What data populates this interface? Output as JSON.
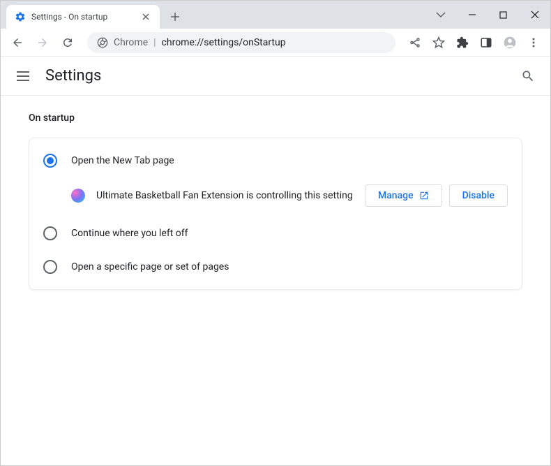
{
  "tab": {
    "title": "Settings - On startup"
  },
  "omnibox": {
    "prefix": "Chrome",
    "url": "chrome://settings/onStartup"
  },
  "settings": {
    "title": "Settings"
  },
  "section": {
    "title": "On startup"
  },
  "options": {
    "open_new_tab": "Open the New Tab page",
    "continue": "Continue where you left off",
    "specific": "Open a specific page or set of pages"
  },
  "extension": {
    "message": "Ultimate Basketball Fan Extension is controlling this setting",
    "manage": "Manage",
    "disable": "Disable"
  }
}
